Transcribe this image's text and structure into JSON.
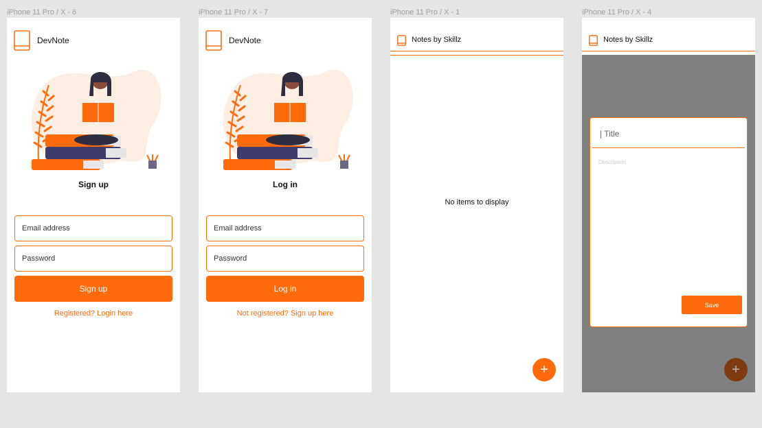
{
  "frames": [
    {
      "label": "iPhone 11 Pro / X - 6"
    },
    {
      "label": "iPhone 11 Pro / X - 7"
    },
    {
      "label": "iPhone 11 Pro / X - 1"
    },
    {
      "label": "iPhone 11 Pro / X - 4"
    }
  ],
  "brand": {
    "name": "DevNote",
    "icon": "book-icon"
  },
  "signup": {
    "title": "Sign up",
    "email_placeholder": "Email address",
    "password_placeholder": "Password",
    "button": "Sign up",
    "link": "Registered? Login here"
  },
  "login": {
    "title": "Log in",
    "email_placeholder": "Email address",
    "password_placeholder": "Password",
    "button": "Log in",
    "link": "Not registered? Sign up here"
  },
  "notes": {
    "app_title": "Notes by Skillz",
    "empty": "No items to display",
    "fab": "+"
  },
  "editor": {
    "title_placeholder": "| Title",
    "description_placeholder": "Description",
    "save": "Save"
  },
  "colors": {
    "accent": "#ff6b0b",
    "canvas": "#e5e5e5",
    "overlay": "#808080",
    "illustration_dark": "#2f2e41"
  }
}
